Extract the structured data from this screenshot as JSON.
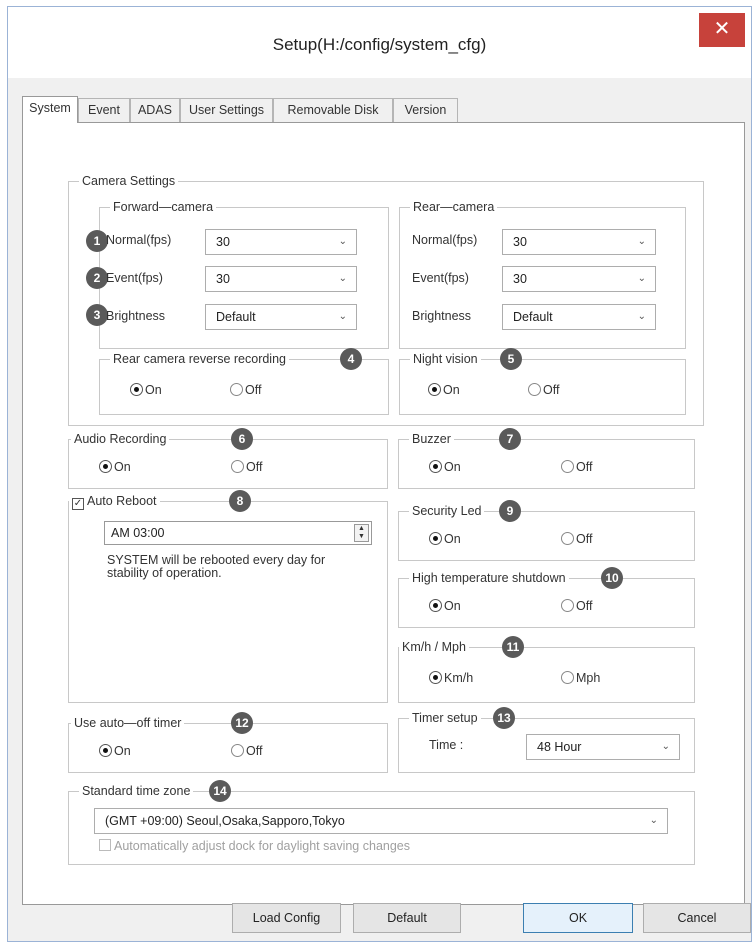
{
  "window": {
    "title": "Setup(H:/config/system_cfg)",
    "close_glyph": "✕"
  },
  "tabs": [
    "System",
    "Event",
    "ADAS",
    "User Settings",
    "Removable Disk",
    "Version"
  ],
  "camera_settings": {
    "legend": "Camera Settings",
    "forward": {
      "legend": "Forward—camera",
      "rows": [
        {
          "badge": "1",
          "label": "Normal(fps)",
          "value": "30"
        },
        {
          "badge": "2",
          "label": "Event(fps)",
          "value": "30"
        },
        {
          "badge": "3",
          "label": "Brightness",
          "value": "Default"
        }
      ]
    },
    "rear": {
      "legend": "Rear—camera",
      "rows": [
        {
          "label": "Normal(fps)",
          "value": "30"
        },
        {
          "label": "Event(fps)",
          "value": "30"
        },
        {
          "label": "Brightness",
          "value": "Default"
        }
      ]
    },
    "rear_reverse": {
      "legend": "Rear camera reverse recording",
      "badge": "4",
      "on": "On",
      "off": "Off",
      "selected": "on"
    },
    "night_vision": {
      "legend": "Night vision",
      "badge": "5",
      "on": "On",
      "off": "Off",
      "selected": "on"
    }
  },
  "audio_recording": {
    "legend": "Audio Recording",
    "badge": "6",
    "on": "On",
    "off": "Off",
    "selected": "on"
  },
  "buzzer": {
    "legend": "Buzzer",
    "badge": "7",
    "on": "On",
    "off": "Off",
    "selected": "on"
  },
  "auto_reboot": {
    "legend": "Auto Reboot",
    "badge": "8",
    "checked": true,
    "check_glyph": "✓",
    "time": "AM 03:00",
    "note_line1": "SYSTEM will be rebooted every day for",
    "note_line2": "stability of operation."
  },
  "security_led": {
    "legend": "Security Led",
    "badge": "9",
    "on": "On",
    "off": "Off",
    "selected": "on"
  },
  "high_temp": {
    "legend": "High temperature shutdown",
    "badge": "10",
    "on": "On",
    "off": "Off",
    "selected": "on"
  },
  "speed_unit": {
    "legend": "Km/h / Mph",
    "badge": "11",
    "on": "Km/h",
    "off": "Mph",
    "selected": "on"
  },
  "auto_off": {
    "legend": "Use auto—off timer",
    "badge": "12",
    "on": "On",
    "off": "Off",
    "selected": "on"
  },
  "timer_setup": {
    "legend": "Timer setup",
    "badge": "13",
    "time_label": "Time :",
    "value": "48 Hour"
  },
  "time_zone": {
    "legend": "Standard time zone",
    "badge": "14",
    "value": "(GMT +09:00) Seoul,Osaka,Sapporo,Tokyo",
    "dst_label": "Automatically adjust dock for daylight saving changes"
  },
  "buttons": {
    "load": "Load Config",
    "default": "Default",
    "ok": "OK",
    "cancel": "Cancel"
  },
  "icons": {
    "chevron": "⌄",
    "spin_up": "▲",
    "spin_down": "▼"
  },
  "colors": {
    "close": "#c7423b",
    "badge": "#5a5a5a"
  }
}
